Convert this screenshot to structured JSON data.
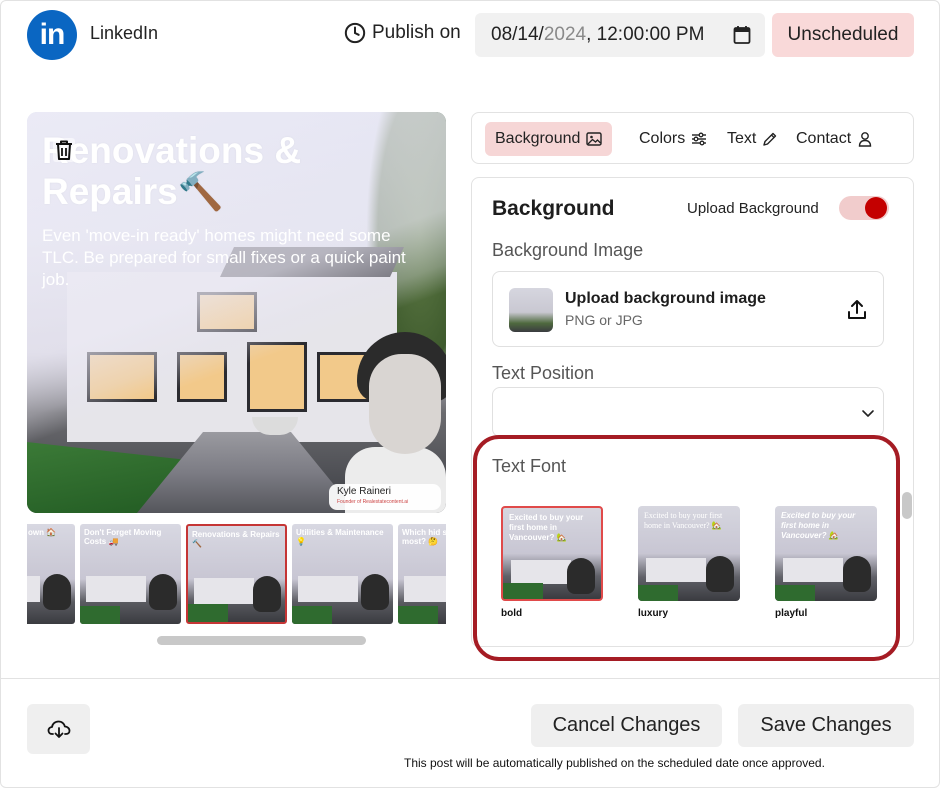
{
  "header": {
    "platform_name": "LinkedIn",
    "logo_text": "in",
    "publish_label": "Publish on",
    "date_prefix": "08/14/",
    "date_year": "2024",
    "date_suffix": ", 12:00:00 PM",
    "status_button": "Unscheduled"
  },
  "preview": {
    "title": "Renovations & Repairs🔨",
    "body": "Even 'move-in ready' homes might need some TLC. Be prepared for small fixes or a quick paint job.",
    "person_name": "Kyle Raineri",
    "person_role": "Founder of Realestatecontent.ai"
  },
  "thumbnails": [
    {
      "title": "own 🏠"
    },
    {
      "title": "Don't Forget Moving Costs 🚚"
    },
    {
      "title": "Renovations & Repairs 🔨"
    },
    {
      "title": "Utilities & Maintenance 💡"
    },
    {
      "title": "Which hid surprised y most? 🤔"
    }
  ],
  "tabs": [
    {
      "label": "Background",
      "icon": "image-icon"
    },
    {
      "label": "Colors",
      "icon": "sliders-icon"
    },
    {
      "label": "Text",
      "icon": "pencil-icon"
    },
    {
      "label": "Contact",
      "icon": "user-icon"
    }
  ],
  "background_panel": {
    "title": "Background",
    "upload_toggle_label": "Upload Background",
    "toggle_on": true,
    "image_label": "Background Image",
    "upload_title": "Upload background image",
    "upload_subtitle": "PNG or JPG",
    "text_position_label": "Text Position",
    "text_position_value": "",
    "text_font_label": "Text Font",
    "font_options": [
      {
        "name": "bold",
        "sample": "Excited to buy your first home in Vancouver? 🏡",
        "selected": true
      },
      {
        "name": "luxury",
        "sample": "Excited to buy your first home in Vancouver? 🏡",
        "selected": false
      },
      {
        "name": "playful",
        "sample": "Excited to buy your first home in Vancouver? 🏡",
        "selected": false
      }
    ]
  },
  "footer": {
    "cancel_label": "Cancel Changes",
    "save_label": "Save Changes",
    "note": "This post will be automatically published on the scheduled date once approved."
  },
  "colors": {
    "linkedin_blue": "#0a66c2",
    "accent_red": "#c40000",
    "highlight_red": "#a51c24",
    "active_tab_bg": "#f6d6d6"
  }
}
